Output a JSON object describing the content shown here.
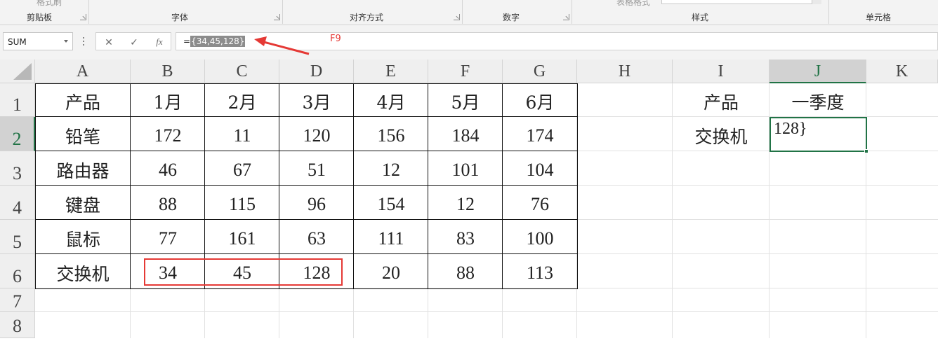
{
  "ribbon": {
    "top_texts": [
      "格式刷",
      "表格格式"
    ],
    "groups": [
      {
        "label": "剪贴板"
      },
      {
        "label": "字体"
      },
      {
        "label": "对齐方式"
      },
      {
        "label": "数字"
      },
      {
        "label": "样式"
      },
      {
        "label": "单元格"
      }
    ]
  },
  "formula_bar": {
    "name_box": "SUM",
    "cancel_icon": "✕",
    "enter_icon": "✓",
    "fx_label": "fx",
    "formula_prefix": "=",
    "formula_selected": "{34,45,128}",
    "annotation": "F9",
    "annotation_color": "#e53935"
  },
  "grid": {
    "columns": [
      "A",
      "B",
      "C",
      "D",
      "E",
      "F",
      "G",
      "H",
      "I",
      "J",
      "K"
    ],
    "rows": [
      "1",
      "2",
      "3",
      "4",
      "5",
      "6",
      "7",
      "8"
    ],
    "active_column": "J",
    "active_row": "2",
    "table": {
      "header": [
        "产品",
        "1月",
        "2月",
        "3月",
        "4月",
        "5月",
        "6月"
      ],
      "rows": [
        [
          "铅笔",
          "172",
          "11",
          "120",
          "156",
          "184",
          "174"
        ],
        [
          "路由器",
          "46",
          "67",
          "51",
          "12",
          "101",
          "104"
        ],
        [
          "键盘",
          "88",
          "115",
          "96",
          "154",
          "12",
          "76"
        ],
        [
          "鼠标",
          "77",
          "161",
          "63",
          "111",
          "83",
          "100"
        ],
        [
          "交换机",
          "34",
          "45",
          "128",
          "20",
          "88",
          "113"
        ]
      ]
    },
    "side": {
      "header_product": "产品",
      "header_quarter": "一季度",
      "product_value": "交换机",
      "editing_value": "128}"
    },
    "highlight_color": "#e53935",
    "accent_color": "#217346"
  }
}
